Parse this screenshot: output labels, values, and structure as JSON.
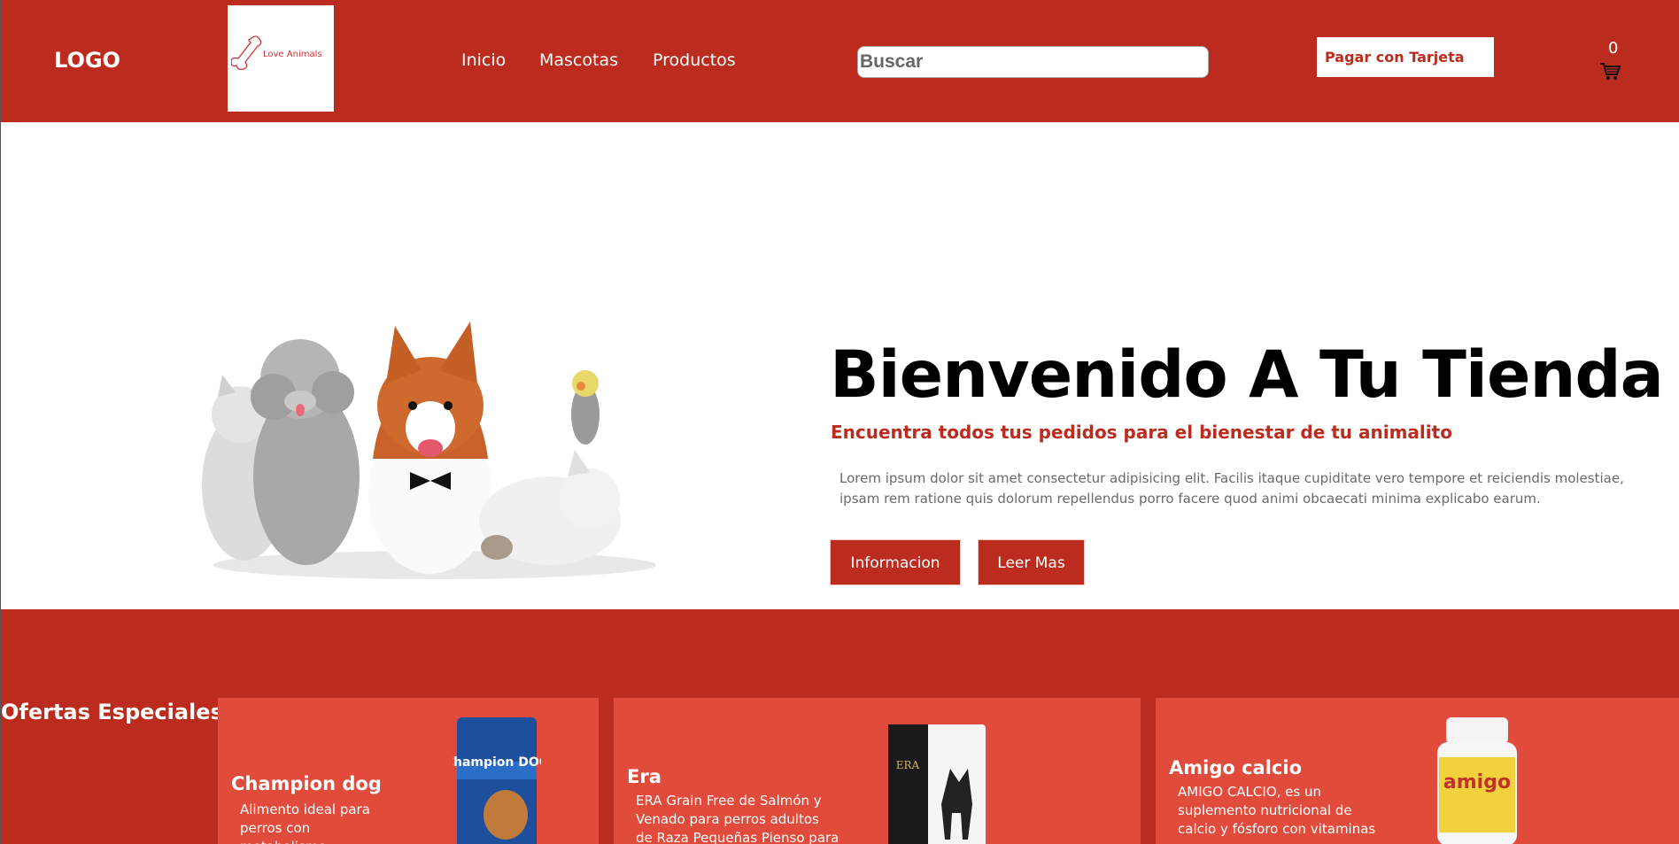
{
  "header": {
    "logo_text": "LOGO",
    "brand_name": "Love Animals",
    "nav": [
      "Inicio",
      "Mascotas",
      "Productos"
    ],
    "search_placeholder": "Buscar",
    "pay_button": "Pagar con Tarjeta",
    "cart_count": "0",
    "cart_icon": "cart-icon",
    "color_brand": "#bc2c1e"
  },
  "hero": {
    "title": "Bienvenido A Tu Tienda",
    "subtitle": "Encuentra todos tus pedidos para el bienestar de tu animalito",
    "description": "Lorem ipsum dolor sit amet consectetur adipisicing elit. Facilis itaque cupiditate vero tempore et reiciendis molestiae, ipsam rem ratione quis dolorum repellendus porro facere quod animi obcaecati minima explicabo earum.",
    "btn_info": "Informacion",
    "btn_more": "Leer Mas"
  },
  "offers": {
    "title": "Ofertas Especiales",
    "cards": [
      {
        "name": "Champion dog",
        "desc": "Alimento ideal para perros con metabolismo",
        "product_label": "Champion DOG"
      },
      {
        "name": "Era",
        "desc": "ERA Grain Free de Salmón y Venado para perros adultos de Raza Pequeñas Pienso para",
        "product_label": "ERA"
      },
      {
        "name": "Amigo calcio",
        "desc": "AMIGO CALCIO, es un suplemento nutricional de calcio y fósforo con vitaminas",
        "product_label": "amigo"
      }
    ]
  }
}
